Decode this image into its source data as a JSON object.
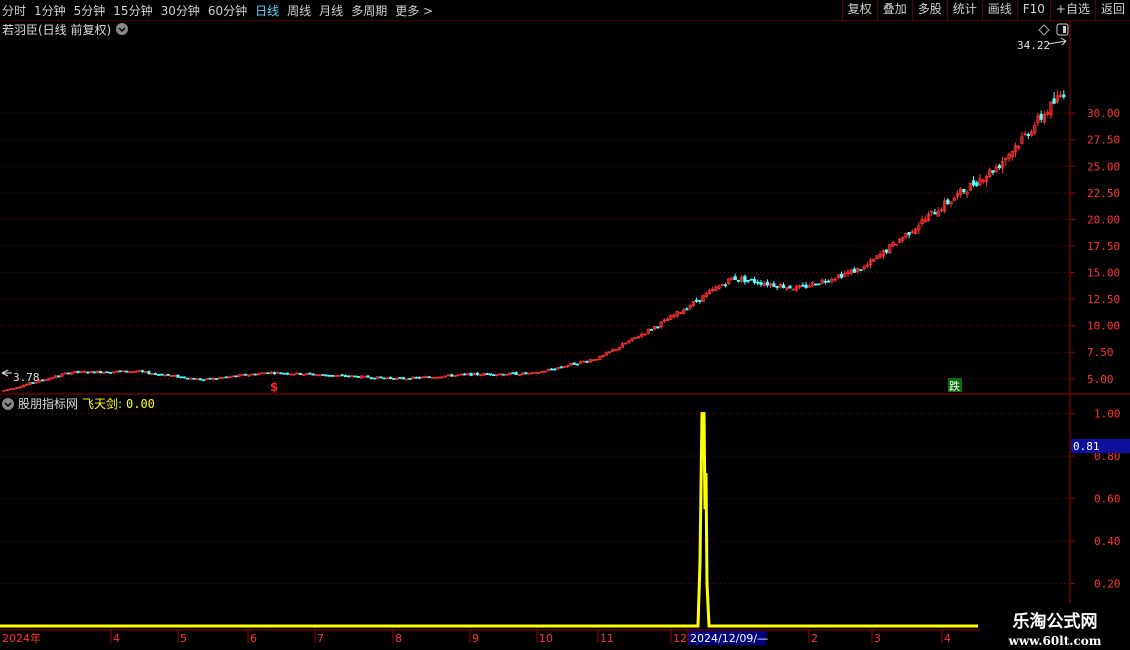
{
  "toolbar": {
    "periods": [
      "分时",
      "1分钟",
      "5分钟",
      "15分钟",
      "30分钟",
      "60分钟",
      "日线",
      "周线",
      "月线",
      "多周期",
      "更多 >"
    ],
    "active_period": "日线",
    "right_buttons": [
      "复权",
      "叠加",
      "多股",
      "统计",
      "画线",
      "F10",
      "+自选",
      "返回"
    ]
  },
  "main_chart": {
    "title": "若羽臣(日线 前复权)",
    "high_label": "34.22",
    "low_label": "3.78",
    "signal_buy": "$",
    "signal_sell": "跌",
    "price_ticks": [
      "30.00",
      "27.50",
      "25.00",
      "22.50",
      "20.00",
      "17.50",
      "15.00",
      "12.50",
      "10.00",
      "7.50",
      "5.00"
    ]
  },
  "indicator": {
    "name": "股朋指标网",
    "series_label": "飞天剑:",
    "series_value": "0.00",
    "current_value": "0.81",
    "ticks": [
      "1.00",
      "0.80",
      "0.60",
      "0.40",
      "0.20"
    ]
  },
  "date_axis": {
    "labels": [
      "2024年",
      "4",
      "5",
      "6",
      "7",
      "8",
      "9",
      "10",
      "11",
      "12",
      "2024/12/09/—",
      "2",
      "3",
      "4"
    ]
  },
  "watermark": {
    "line1": "乐淘公式网",
    "line2": "www.60lt.com"
  },
  "colors": {
    "up": "#ff3232",
    "down": "#54ffff",
    "indicator": "#ffff00",
    "grid": "#8b0000",
    "date_highlight": "#000080"
  },
  "chart_data": {
    "type": "candlestick+line",
    "price_range": [
      3.0,
      35.0
    ],
    "approx_close_path": [
      {
        "date": "2024-01",
        "close": 3.9
      },
      {
        "date": "2024-02",
        "close": 5.6
      },
      {
        "date": "2024-03",
        "close": 5.7
      },
      {
        "date": "2024-04",
        "close": 4.9
      },
      {
        "date": "2024-05",
        "close": 5.6
      },
      {
        "date": "2024-06",
        "close": 5.3
      },
      {
        "date": "2024-07",
        "close": 5.0
      },
      {
        "date": "2024-08",
        "close": 5.4
      },
      {
        "date": "2024-09",
        "close": 5.5
      },
      {
        "date": "2024-10",
        "close": 7.0
      },
      {
        "date": "2024-11",
        "close": 10.5
      },
      {
        "date": "2024-12",
        "close": 14.5
      },
      {
        "date": "2025-01",
        "close": 13.5
      },
      {
        "date": "2025-02",
        "close": 15.5
      },
      {
        "date": "2025-03",
        "close": 20.5
      },
      {
        "date": "2025-04",
        "close": 25.0
      },
      {
        "date": "2025-05",
        "close": 32.0
      }
    ],
    "indicator_series": {
      "name": "飞天剑",
      "baseline": 0,
      "spike_date": "2024/12/09",
      "spike_peak": 1.0,
      "indicator_range": [
        0,
        1.05
      ]
    }
  }
}
